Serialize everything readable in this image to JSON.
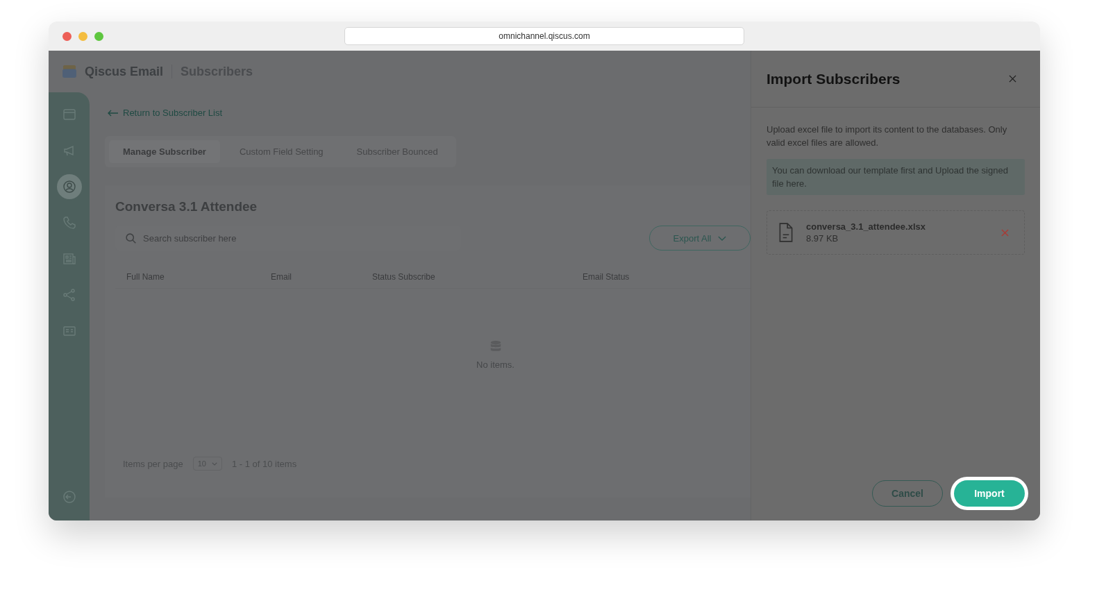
{
  "browser": {
    "url": "omnichannel.qiscus.com"
  },
  "app": {
    "title": "Qiscus Email",
    "section": "Subscribers"
  },
  "sidebar": {
    "items": [
      {
        "kind": "window",
        "selected": false
      },
      {
        "kind": "megaphone",
        "selected": false
      },
      {
        "kind": "user",
        "selected": true
      },
      {
        "kind": "phone",
        "selected": false
      },
      {
        "kind": "news",
        "selected": false
      },
      {
        "kind": "share",
        "selected": false
      },
      {
        "kind": "card",
        "selected": false
      }
    ]
  },
  "back_link": "Return to Subscriber List",
  "tabs": [
    {
      "label": "Manage Subscriber",
      "selected": true
    },
    {
      "label": "Custom Field Setting",
      "selected": false
    },
    {
      "label": "Subscriber Bounced",
      "selected": false
    }
  ],
  "list_title": "Conversa 3.1 Attendee",
  "search": {
    "placeholder": "Search subscriber here"
  },
  "export_button": "Export All",
  "table": {
    "columns": [
      "Full Name",
      "Email",
      "Status Subscribe",
      "Email Status"
    ],
    "empty_text": "No items."
  },
  "pagination": {
    "label": "Items per page",
    "page_size": "10",
    "summary": "1 - 1 of 10 items"
  },
  "drawer": {
    "title": "Import Subscribers",
    "description": "Upload excel file to import its content to the databases. Only valid excel files are allowed.",
    "note": "You can download our template first and Upload the signed file here.",
    "file": {
      "name": "conversa_3.1_attendee.xlsx",
      "size": "8.97 KB"
    },
    "cancel": "Cancel",
    "import": "Import"
  }
}
